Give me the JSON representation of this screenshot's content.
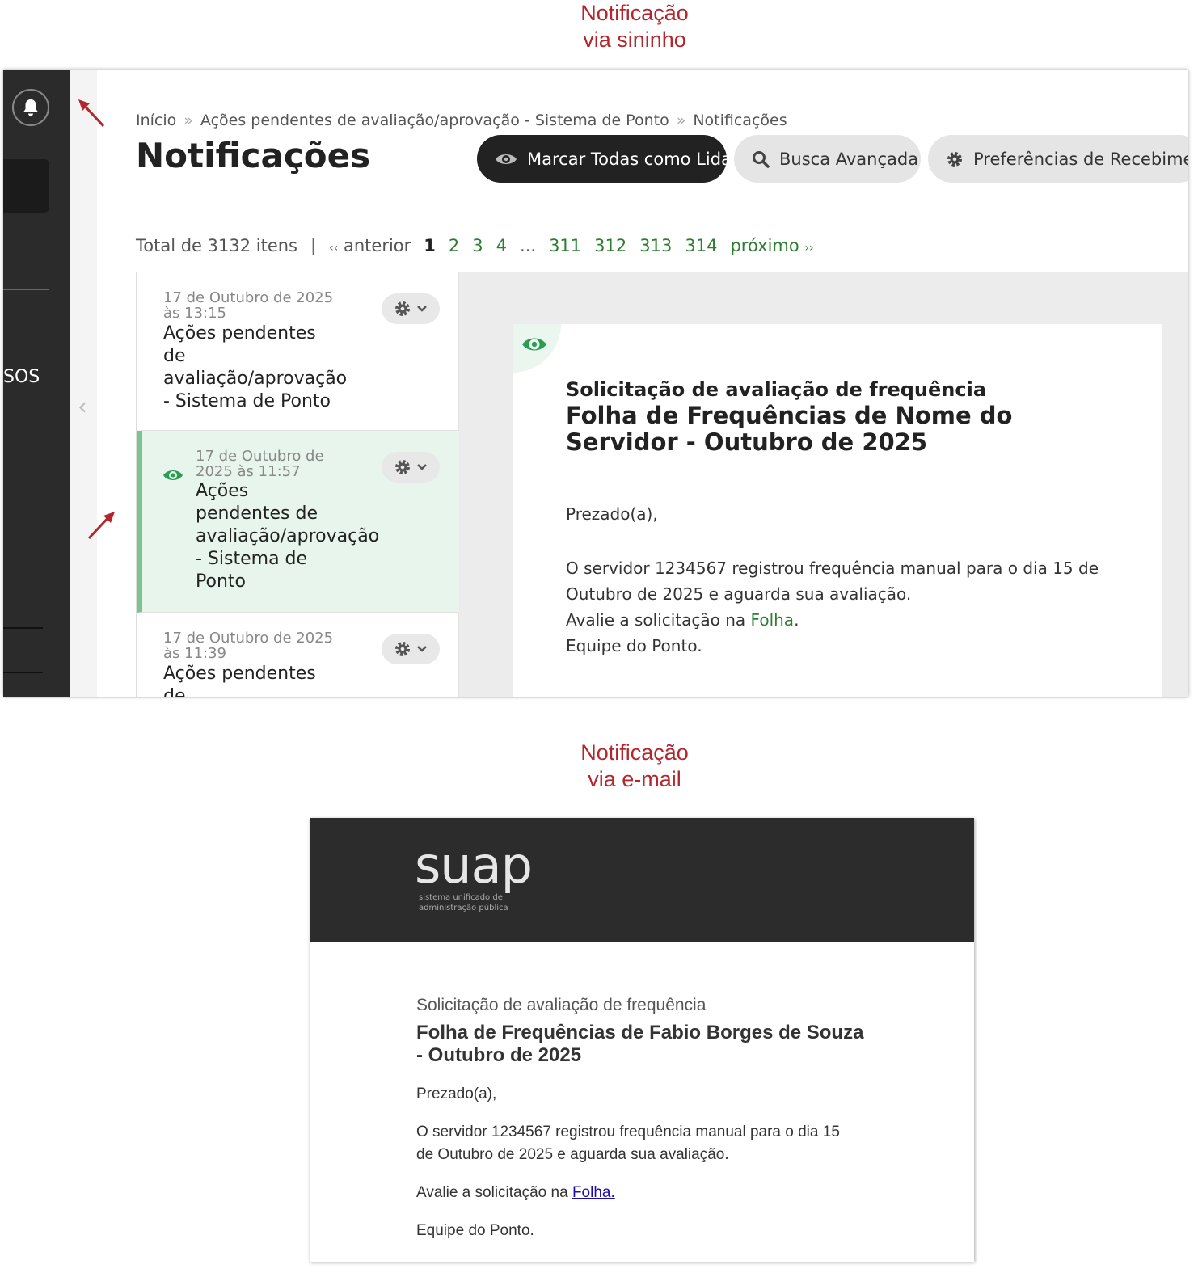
{
  "captions": {
    "bell": [
      "Notificação",
      "via sininho"
    ],
    "email": [
      "Notificação",
      "via e-mail"
    ]
  },
  "app": {
    "sidebar_text": "SOS",
    "breadcrumb": [
      "Início",
      "Ações pendentes de avaliação/aprovação - Sistema de Ponto",
      "Notificações"
    ],
    "page_title": "Notificações",
    "buttons": {
      "mark_all": "Marcar Todas como Lida",
      "search": "Busca Avançada",
      "preferences": "Preferências de Recebiment"
    },
    "pagination": {
      "total": "Total de 3132 itens",
      "separator": "|",
      "prev_arrows": "‹‹",
      "prev": "anterior",
      "current": "1",
      "pages": [
        "2",
        "3",
        "4"
      ],
      "ellipsis": "...",
      "last_pages": [
        "311",
        "312",
        "313",
        "314"
      ],
      "next": "próximo",
      "next_arrows": "››"
    },
    "notifications": [
      {
        "date": [
          "17 de Outubro de 2025",
          "às 13:15"
        ],
        "title": [
          "Ações pendentes",
          "de",
          "avaliação/aprovação",
          "- Sistema de Ponto"
        ]
      },
      {
        "date": [
          "17 de Outubro de",
          "2025 às 11:57"
        ],
        "title": [
          "Ações",
          "pendentes de",
          "avaliação/aprovação",
          "- Sistema de",
          "Ponto"
        ]
      },
      {
        "date": [
          "17 de Outubro de 2025",
          "às 11:39"
        ],
        "title": [
          "Ações pendentes",
          "de"
        ]
      }
    ],
    "detail": {
      "subject": "Solicitação de avaliação de frequência",
      "heading": "Folha de Frequências de Nome do Servidor - Outubro de 2025",
      "greeting": "Prezado(a),",
      "body_line1": "O servidor 1234567 registrou frequência manual para o dia 15 de",
      "body_line2": "Outubro de 2025 e aguarda sua avaliação.",
      "review_prefix": "Avalie a solicitação na ",
      "review_link": "Folha",
      "review_suffix": ".",
      "signature": "Equipe do Ponto."
    }
  },
  "email": {
    "logo": "suap",
    "logo_tagline": [
      "sistema unificado de",
      "administração pública"
    ],
    "subject": "Solicitação de avaliação de frequência",
    "heading": "Folha de Frequências de Fabio Borges de Souza - Outubro de 2025",
    "greeting": "Prezado(a),",
    "body_line1": "O servidor 1234567 registrou frequência manual para o dia 15",
    "body_line2": "de Outubro de 2025 e aguarda sua avaliação.",
    "review_prefix": "Avalie a solicitação na ",
    "review_link": "Folha.",
    "signature": "Equipe do Ponto."
  },
  "colors": {
    "caption": "#b3262d",
    "sidebar": "#2b2b2b",
    "primary_button": "#222222",
    "accent_green": "#2e7d32",
    "selected_item_bg": "#e8f5ec",
    "email_link": "#1a0dab",
    "arrow": "#b3262d"
  },
  "icons": [
    "bell-icon",
    "eye-icon",
    "search-icon",
    "gear-icon",
    "chevron-down-icon",
    "chevron-left-icon",
    "arrow-icon"
  ]
}
